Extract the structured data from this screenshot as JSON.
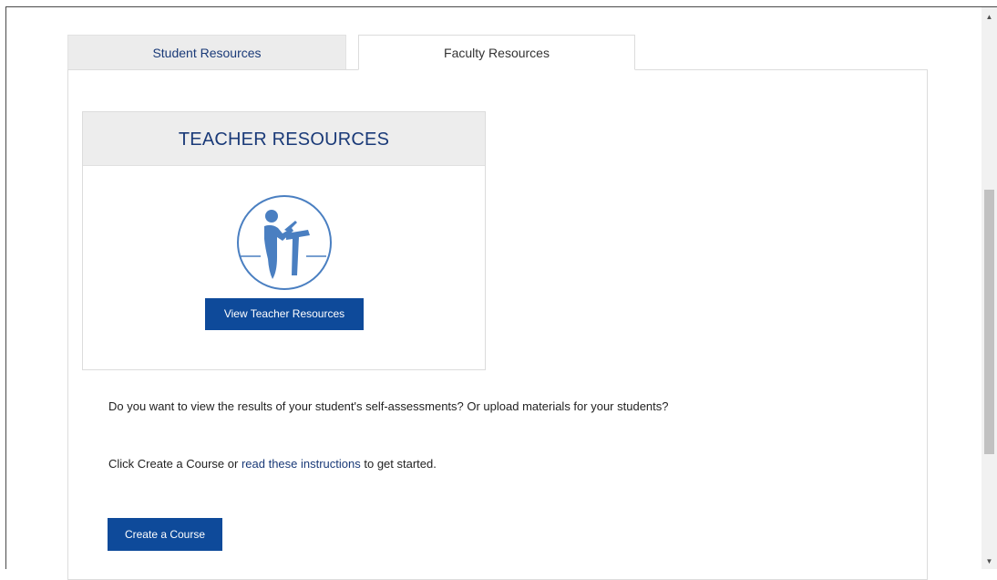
{
  "tabs": [
    {
      "label": "Student Resources",
      "active": false
    },
    {
      "label": "Faculty Resources",
      "active": true
    }
  ],
  "card": {
    "title": "TEACHER RESOURCES",
    "icon": "teacher-at-podium-icon",
    "button_label": "View Teacher Resources"
  },
  "info": {
    "question": "Do you want to view the results of your student's self-assessments? Or upload materials for your students?",
    "instruction_prefix": "Click Create a Course or ",
    "instruction_link": "read these instructions",
    "instruction_suffix": " to get started."
  },
  "create_button_label": "Create a Course",
  "colors": {
    "accent": "#0e4a9a",
    "heading": "#1a3a78",
    "icon": "#4a7fc1"
  }
}
